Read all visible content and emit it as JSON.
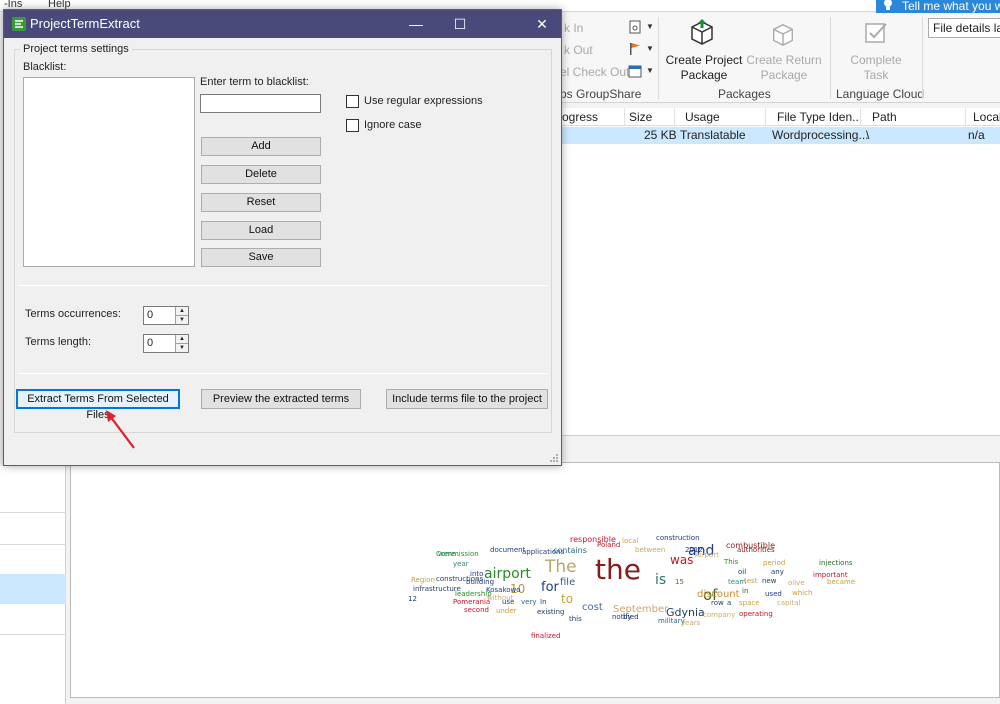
{
  "background": {
    "menu": [
      "-Ins",
      "Help"
    ],
    "tell_me": "Tell me what you wa",
    "ribbon": {
      "dim_items": [
        "k In",
        "k Out",
        "el Check Out"
      ],
      "groupshare_label": "ps GroupShare",
      "create_project_package": [
        "Create Project",
        "Package"
      ],
      "create_return_package": [
        "Create Return",
        "Package"
      ],
      "packages_label": "Packages",
      "complete_task": [
        "Complete",
        "Task"
      ],
      "language_cloud_label": "Language Cloud",
      "file_details_value": "File details lay"
    },
    "grid": {
      "columns": [
        "ogress",
        "Size",
        "Usage",
        "File Type Iden...",
        "Path",
        "Local"
      ],
      "row": {
        "size": "25 KB",
        "usage": "Translatable",
        "file_type": "Wordprocessing...",
        "path": "\\",
        "local": "n/a"
      }
    },
    "word_cloud": [
      {
        "w": "the",
        "c": "#8b1a1a"
      },
      {
        "w": "airport",
        "c": "#2a8a2a"
      },
      {
        "w": "The",
        "c": "#b5a66a"
      },
      {
        "w": "and",
        "c": "#1f3a8a"
      },
      {
        "w": "of",
        "c": "#2a6a2a"
      },
      {
        "w": "is",
        "c": "#2a7a6a"
      },
      {
        "w": "was",
        "c": "#c4162a"
      },
      {
        "w": "for",
        "c": "#1f3a8a"
      },
      {
        "w": "to",
        "c": "#c9a23a"
      },
      {
        "w": "10",
        "c": "#b5953a"
      },
      {
        "w": "Gdynia",
        "c": "#1f3a5a"
      },
      {
        "w": "September",
        "c": "#c9a86a"
      },
      {
        "w": "discount",
        "c": "#d08a2a"
      },
      {
        "w": "cost",
        "c": "#4a6a9a"
      },
      {
        "w": "file",
        "c": "#3a5a8a"
      },
      {
        "w": "responsible",
        "c": "#c4162a"
      },
      {
        "w": "local",
        "c": "#d0a040"
      },
      {
        "w": "construction",
        "c": "#1f3a8a"
      },
      {
        "w": "combustible",
        "c": "#8b1a1a"
      },
      {
        "w": "Commission",
        "c": "#2a8a2a"
      },
      {
        "w": "document",
        "c": "#1f3a8a"
      },
      {
        "w": "applications",
        "c": "#1f3a8a"
      },
      {
        "w": "contains",
        "c": "#2a6a8a"
      },
      {
        "w": "Poland",
        "c": "#c4162a"
      },
      {
        "w": "between",
        "c": "#c9a86a"
      },
      {
        "w": "2012",
        "c": "#1f3a8a"
      },
      {
        "w": "Airport",
        "c": "#c9b070"
      },
      {
        "w": "authorities",
        "c": "#8b1a1a"
      },
      {
        "w": "were",
        "c": "#2a8a6a"
      },
      {
        "w": "This",
        "c": "#2a8a2a"
      },
      {
        "w": "period",
        "c": "#c9a040"
      },
      {
        "w": "injections",
        "c": "#2a6a2a"
      },
      {
        "w": "year",
        "c": "#2a8a6a"
      },
      {
        "w": "into",
        "c": "#1f3a8a"
      },
      {
        "w": "oil",
        "c": "#1f3a5a"
      },
      {
        "w": "any",
        "c": "#1f3a5a"
      },
      {
        "w": "important",
        "c": "#c4162a"
      },
      {
        "w": "constructions",
        "c": "#1f3a5a"
      },
      {
        "w": "building",
        "c": "#1f3a8a"
      },
      {
        "w": "15",
        "c": "#2a8a2a"
      },
      {
        "w": "team",
        "c": "#2a8a8a"
      },
      {
        "w": "test",
        "c": "#c9a040"
      },
      {
        "w": "new",
        "c": "#1f3a5a"
      },
      {
        "w": "olive",
        "c": "#c9a86a"
      },
      {
        "w": "became",
        "c": "#c9a040"
      },
      {
        "w": "Region",
        "c": "#c4a040"
      },
      {
        "w": "Kosakowo",
        "c": "#1f3a8a"
      },
      {
        "w": "in",
        "c": "#2a6a2a"
      },
      {
        "w": "used",
        "c": "#1f3a8a"
      },
      {
        "w": "which",
        "c": "#c9a040"
      },
      {
        "w": "infrastructure",
        "c": "#1f3a5a"
      },
      {
        "w": "leadership",
        "c": "#2a8a2a"
      },
      {
        "w": "without",
        "c": "#c9b070"
      },
      {
        "w": "12",
        "c": "#1f3a5a"
      },
      {
        "w": "Pomerania",
        "c": "#c4162a"
      },
      {
        "w": "use",
        "c": "#1f3a5a"
      },
      {
        "w": "very",
        "c": "#2a6a8a"
      },
      {
        "w": "In",
        "c": "#1f3a8a"
      },
      {
        "w": "row",
        "c": "#1f3a5a"
      },
      {
        "w": "a",
        "c": "#1f3a5a"
      },
      {
        "w": "space",
        "c": "#d0a040"
      },
      {
        "w": "capital",
        "c": "#c9b070"
      },
      {
        "w": "second",
        "c": "#c4162a"
      },
      {
        "w": "under",
        "c": "#c9a040"
      },
      {
        "w": "existing",
        "c": "#1f3a5a"
      },
      {
        "w": "notified",
        "c": "#1f3a8a"
      },
      {
        "w": "by",
        "c": "#1f3a5a"
      },
      {
        "w": "company",
        "c": "#c9b070"
      },
      {
        "w": "operating",
        "c": "#c4162a"
      },
      {
        "w": "this",
        "c": "#1f3a8a"
      },
      {
        "w": "military",
        "c": "#2a6a8a"
      },
      {
        "w": "years",
        "c": "#c9a86a"
      },
      {
        "w": "finalized",
        "c": "#c4162a"
      }
    ]
  },
  "dialog": {
    "title": "ProjectTermExtract",
    "group_label": "Project terms settings",
    "blacklist_label": "Blacklist:",
    "enter_term_label": "Enter term to blacklist:",
    "term_input_value": "",
    "buttons": {
      "add": "Add",
      "delete": "Delete",
      "reset": "Reset",
      "load": "Load",
      "save": "Save"
    },
    "use_regex_label": "Use regular expressions",
    "ignore_case_label": "Ignore case",
    "terms_occurrences_label": "Terms  occurrences:",
    "terms_occurrences_value": "0",
    "terms_length_label": "Terms length:",
    "terms_length_value": "0",
    "extract_button": "Extract Terms From Selected Files",
    "preview_button": "Preview the extracted terms",
    "include_button": "Include terms file to the project",
    "window_controls": {
      "minimize": "—",
      "maximize": "☐",
      "close": "✕"
    }
  },
  "colors": {
    "title_bar": "#4a4a7a",
    "focus_border": "#0078d7",
    "selection": "#cce8ff",
    "annotation_arrow": "#e0202a"
  }
}
